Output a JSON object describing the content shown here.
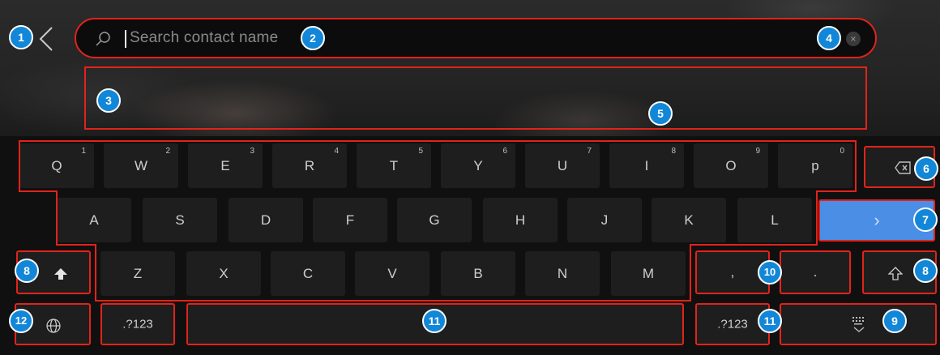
{
  "search": {
    "placeholder": "Search contact name",
    "clear_symbol": "×"
  },
  "keyboard": {
    "row1": [
      {
        "key": "Q",
        "num": "1"
      },
      {
        "key": "W",
        "num": "2"
      },
      {
        "key": "E",
        "num": "3"
      },
      {
        "key": "R",
        "num": "4"
      },
      {
        "key": "T",
        "num": "5"
      },
      {
        "key": "Y",
        "num": "6"
      },
      {
        "key": "U",
        "num": "7"
      },
      {
        "key": "I",
        "num": "8"
      },
      {
        "key": "O",
        "num": "9"
      },
      {
        "key": "p",
        "num": "0"
      }
    ],
    "row2": [
      "A",
      "S",
      "D",
      "F",
      "G",
      "H",
      "J",
      "K",
      "L"
    ],
    "row3": [
      "Z",
      "X",
      "C",
      "V",
      "B",
      "N",
      "M"
    ],
    "comma": ",",
    "period": ".",
    "symbols_left": ".?123",
    "symbols_right": ".?123",
    "enter_symbol": "›"
  },
  "badges": [
    "1",
    "2",
    "3",
    "4",
    "5",
    "6",
    "7",
    "8",
    "8",
    "9",
    "10",
    "11",
    "11",
    "12"
  ],
  "colors": {
    "annotation_outline": "#e2231a",
    "badge": "#1287d8",
    "enter_key": "#4a8ee6",
    "background": "#121212"
  },
  "icons": [
    "back-chevron-icon",
    "search-icon",
    "clear-icon",
    "backspace-icon",
    "shift-filled-icon",
    "shift-outline-icon",
    "globe-icon",
    "keyboard-hide-icon"
  ]
}
